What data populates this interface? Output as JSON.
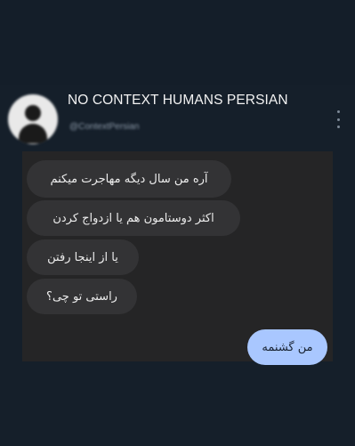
{
  "header": {
    "account_name": "NO CONTEXT HUMANS PERSIAN",
    "account_handle": "@ContextPersian",
    "more_icon": "more-vertical-icon"
  },
  "chat": {
    "received_messages": [
      "آره  من سال دیگه مهاجرت میکنم",
      "اکثر  دوستامون هم یا ازدواج کردن",
      "یا از اینجا رفتن",
      "راستی تو چی؟"
    ],
    "sent_messages": [
      "من گشنمه"
    ]
  },
  "colors": {
    "background": "#151f2a",
    "chat_panel": "#252526",
    "received_bubble": "#333335",
    "sent_bubble": "#a9c7ff"
  }
}
